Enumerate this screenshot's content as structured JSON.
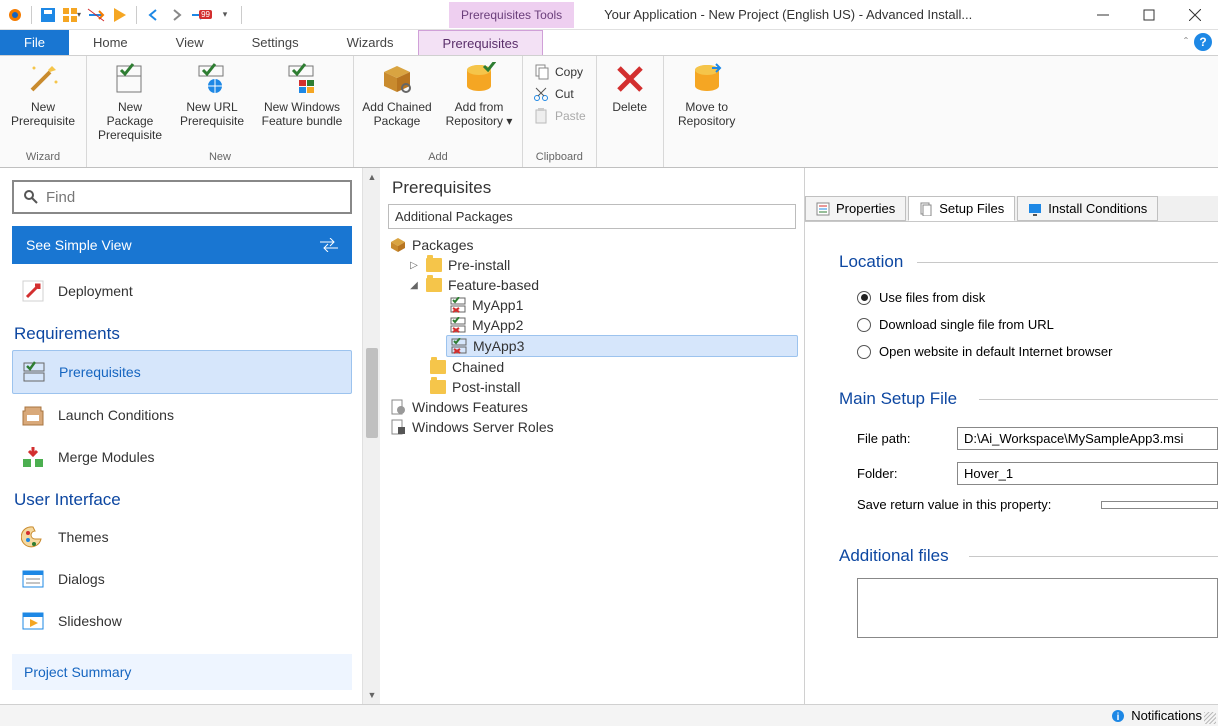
{
  "titlebar": {
    "contextual": "Prerequisites Tools",
    "title": "Your Application - New Project (English US) - Advanced Install..."
  },
  "tabs": {
    "file": "File",
    "home": "Home",
    "view": "View",
    "settings": "Settings",
    "wizards": "Wizards",
    "prereq": "Prerequisites"
  },
  "ribbon": {
    "wizard": {
      "label": "Wizard",
      "newPrereq": "New\nPrerequisite"
    },
    "newGroup": {
      "label": "New",
      "newPkg": "New Package\nPrerequisite",
      "newUrl": "New URL\nPrerequisite",
      "newBundle": "New Windows\nFeature bundle"
    },
    "addGroup": {
      "label": "Add",
      "chained": "Add Chained\nPackage",
      "repo": "Add from\nRepository"
    },
    "clipboard": {
      "label": "Clipboard",
      "copy": "Copy",
      "cut": "Cut",
      "paste": "Paste"
    },
    "delete": "Delete",
    "moveRepo": "Move to\nRepository"
  },
  "search": {
    "placeholder": "Find"
  },
  "simpleView": "See Simple View",
  "nav": {
    "deployment": "Deployment",
    "requirements": "Requirements",
    "prerequisites": "Prerequisites",
    "launch": "Launch Conditions",
    "merge": "Merge Modules",
    "ui": "User Interface",
    "themes": "Themes",
    "dialogs": "Dialogs",
    "slideshow": "Slideshow",
    "projSummary": "Project Summary"
  },
  "tree": {
    "heading": "Prerequisites",
    "subheading": "Additional Packages",
    "packages": "Packages",
    "preinstall": "Pre-install",
    "feature": "Feature-based",
    "app1": "MyApp1",
    "app2": "MyApp2",
    "app3": "MyApp3",
    "chained": "Chained",
    "postinstall": "Post-install",
    "winfeat": "Windows Features",
    "winroles": "Windows Server Roles"
  },
  "detailTabs": {
    "props": "Properties",
    "setup": "Setup Files",
    "install": "Install Conditions"
  },
  "detail": {
    "location": "Location",
    "loc1": "Use files from disk",
    "loc2": "Download single file from URL",
    "loc3": "Open website in default Internet browser",
    "mainSetup": "Main Setup File",
    "filepathLabel": "File path:",
    "filepath": "D:\\Ai_Workspace\\MySampleApp3.msi",
    "folderLabel": "Folder:",
    "folder": "Hover_1",
    "saveProp": "Save return value in this property:",
    "additional": "Additional files"
  },
  "status": {
    "notifications": "Notifications"
  }
}
